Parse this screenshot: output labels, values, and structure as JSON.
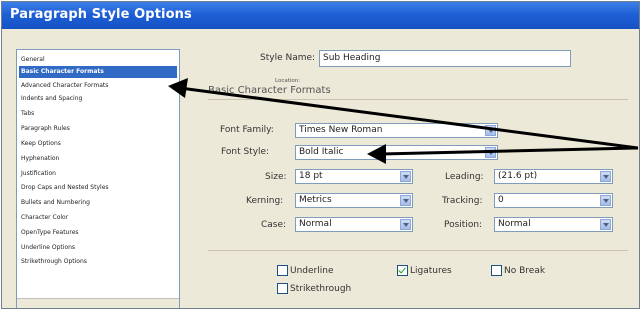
{
  "window": {
    "title": "Paragraph Style Options"
  },
  "sidebar": {
    "items": [
      {
        "label": "General",
        "selected": false
      },
      {
        "label": "Basic Character Formats",
        "selected": true
      },
      {
        "label": "Advanced Character Formats",
        "selected": false
      },
      {
        "label": "Indents and Spacing",
        "selected": false
      },
      {
        "label": "Tabs",
        "selected": false
      },
      {
        "label": "Paragraph Rules",
        "selected": false
      },
      {
        "label": "Keep Options",
        "selected": false
      },
      {
        "label": "Hyphenation",
        "selected": false
      },
      {
        "label": "Justification",
        "selected": false
      },
      {
        "label": "Drop Caps and Nested Styles",
        "selected": false
      },
      {
        "label": "Bullets and Numbering",
        "selected": false
      },
      {
        "label": "Character Color",
        "selected": false
      },
      {
        "label": "OpenType Features",
        "selected": false
      },
      {
        "label": "Underline Options",
        "selected": false
      },
      {
        "label": "Strikethrough Options",
        "selected": false
      }
    ]
  },
  "form": {
    "style_name_label": "Style Name:",
    "style_name_value": "Sub Heading",
    "location_label": "Location:",
    "section_title": "Basic Character Formats",
    "font_family_label": "Font Family:",
    "font_family_value": "Times New Roman",
    "font_style_label": "Font Style:",
    "font_style_value": "Bold Italic",
    "size_label": "Size:",
    "size_value": "18 pt",
    "leading_label": "Leading:",
    "leading_value": "(21.6 pt)",
    "kerning_label": "Kerning:",
    "kerning_value": "Metrics",
    "tracking_label": "Tracking:",
    "tracking_value": "0",
    "case_label": "Case:",
    "case_value": "Normal",
    "position_label": "Position:",
    "position_value": "Normal",
    "underline_label": "Underline",
    "underline_checked": false,
    "ligatures_label": "Ligatures",
    "ligatures_checked": true,
    "no_break_label": "No Break",
    "no_break_checked": false,
    "strikethrough_label": "Strikethrough",
    "strikethrough_checked": false
  },
  "colors": {
    "titlebar": "#1f5fd6",
    "selection": "#316ac5",
    "annotation_arrow": "#000000"
  }
}
